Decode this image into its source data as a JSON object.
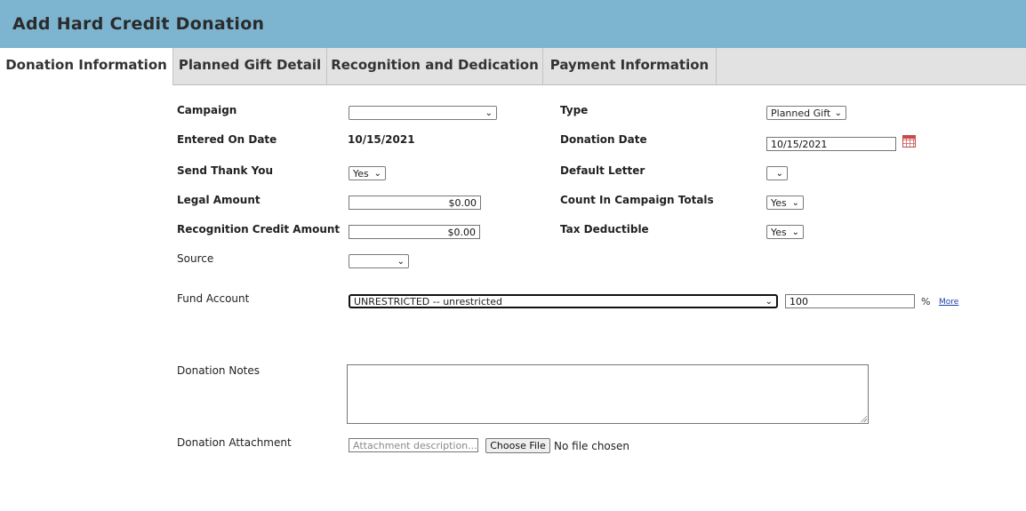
{
  "header": {
    "title": "Add Hard Credit Donation"
  },
  "tabs": [
    {
      "label": "Donation Information"
    },
    {
      "label": "Planned Gift Detail"
    },
    {
      "label": "Recognition and Dedication"
    },
    {
      "label": "Payment Information"
    }
  ],
  "form": {
    "campaign": {
      "label": "Campaign",
      "value": ""
    },
    "type": {
      "label": "Type",
      "value": "Planned Gift"
    },
    "entered_on_date": {
      "label": "Entered On Date",
      "value": "10/15/2021"
    },
    "donation_date": {
      "label": "Donation Date",
      "value": "10/15/2021"
    },
    "send_thank_you": {
      "label": "Send Thank You",
      "value": "Yes"
    },
    "default_letter": {
      "label": "Default Letter",
      "value": ""
    },
    "legal_amount": {
      "label": "Legal Amount",
      "value": "$0.00"
    },
    "count_in_campaign_totals": {
      "label": "Count In Campaign Totals",
      "value": "Yes"
    },
    "recognition_credit_amount": {
      "label": "Recognition Credit Amount",
      "value": "$0.00"
    },
    "tax_deductible": {
      "label": "Tax Deductible",
      "value": "Yes"
    },
    "source": {
      "label": "Source",
      "value": ""
    },
    "fund_account": {
      "label": "Fund Account",
      "value": "UNRESTRICTED -- unrestricted",
      "percent": "100",
      "percent_symbol": "%",
      "more_link": "More"
    },
    "donation_notes": {
      "label": "Donation Notes",
      "value": ""
    },
    "donation_attachment": {
      "label": "Donation Attachment",
      "placeholder": "Attachment description...",
      "button_label": "Choose File",
      "no_file_text": "No file chosen"
    }
  },
  "icons": {
    "calendar": "calendar-icon",
    "dropdown": "chevron-down-icon"
  },
  "colors": {
    "header_bg": "#7db5d1",
    "tab_bg": "#e2e2e2",
    "link": "#1a3fa8"
  }
}
